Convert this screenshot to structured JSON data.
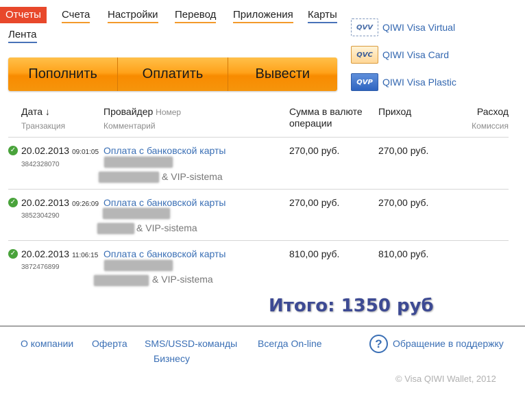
{
  "nav": {
    "items": [
      {
        "label": "Отчеты",
        "active": true
      },
      {
        "label": "Счета"
      },
      {
        "label": "Настройки"
      },
      {
        "label": "Перевод"
      },
      {
        "label": "Приложения"
      },
      {
        "label": "Карты"
      },
      {
        "label": "Лента"
      }
    ]
  },
  "actions": [
    "Пополнить",
    "Оплатить",
    "Вывести"
  ],
  "cards": [
    {
      "icon": "qvv-card-icon",
      "badge": "QVV",
      "label": "QIWI Visa Virtual"
    },
    {
      "icon": "qvc-card-icon",
      "badge": "QVC",
      "label": "QIWI Visa Card"
    },
    {
      "icon": "qvp-card-icon",
      "badge": "QVP",
      "label": "QIWI Visa Plastic"
    }
  ],
  "table": {
    "headers": {
      "date": "Дата ↓",
      "date_sub": "Транзакция",
      "provider": "Провайдер",
      "provider_number": "Номер",
      "provider_sub": "Комментарий",
      "amount_line1": "Сумма в валюте",
      "amount_line2": "операции",
      "income": "Приход",
      "expense": "Расход",
      "expense_sub": "Комиссия"
    },
    "rows": [
      {
        "date": "20.02.2013",
        "time": "09:01:05",
        "id": "3842328070",
        "link": "Оплата с банковской карты",
        "provider": "& VIP-sistema",
        "amount": "270,00 руб.",
        "income": "270,00 руб."
      },
      {
        "date": "20.02.2013",
        "time": "09:26:09",
        "id": "3852304290",
        "link": "Оплата с банковской карты",
        "provider": "& VIP-sistema",
        "amount": "270,00 руб.",
        "income": "270,00 руб."
      },
      {
        "date": "20.02.2013",
        "time": "11:06:15",
        "id": "3872476899",
        "link": "Оплата с банковской карты",
        "provider": "& VIP-sistema",
        "amount": "810,00 руб.",
        "income": "810,00 руб."
      }
    ]
  },
  "total": "Итого: 1350 руб",
  "footer": {
    "links": [
      "О компании",
      "Оферта",
      "SMS/USSD-команды",
      "Всегда On-line",
      "Бизнесу"
    ],
    "support": "Обращение в поддержку",
    "help_symbol": "?",
    "copyright": "© Visa QIWI Wallet, 2012"
  },
  "colors": {
    "accent_orange": "#f88b00",
    "active_tab": "#e8482b",
    "link_blue": "#3a6fb5",
    "success_green": "#49a33b",
    "total_blue": "#3d4a93"
  }
}
